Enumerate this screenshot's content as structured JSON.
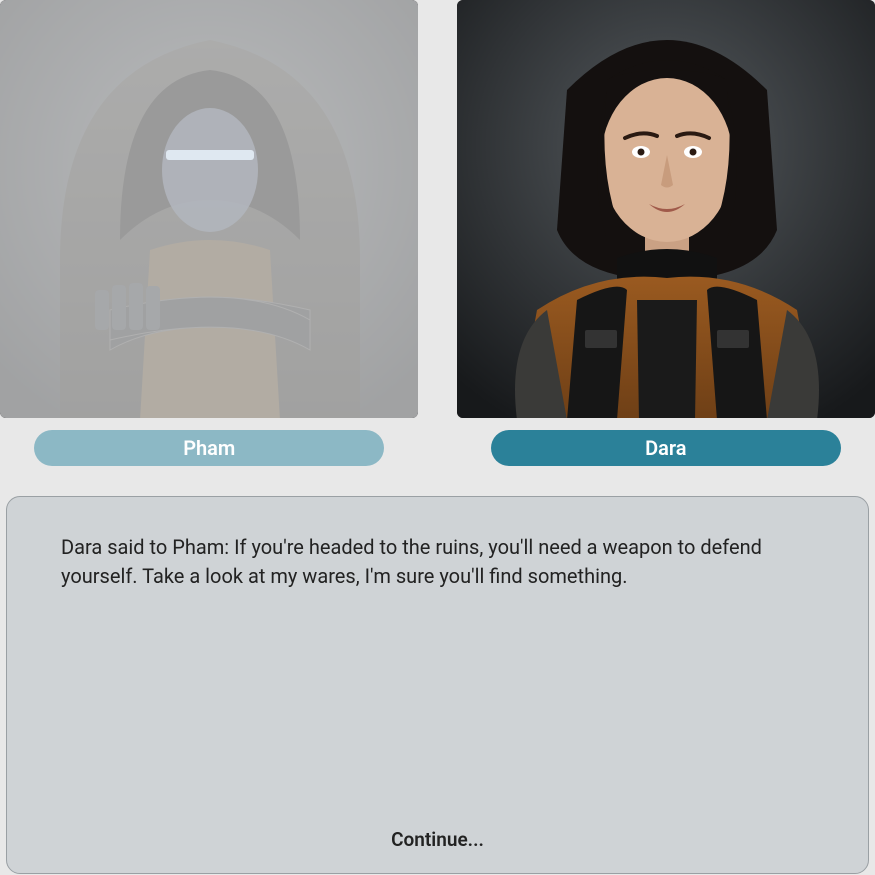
{
  "characters": {
    "left": {
      "name": "Pham",
      "active": false
    },
    "right": {
      "name": "Dara",
      "active": true
    }
  },
  "dialog": {
    "text": "Dara said to Pham: If you're headed to the ruins, you'll need a weapon to defend yourself. Take a look at my wares, I'm sure you'll find something.",
    "continue_label": "Continue..."
  },
  "colors": {
    "pill_active": "#2b8199",
    "pill_inactive": "#8cb8c5"
  }
}
